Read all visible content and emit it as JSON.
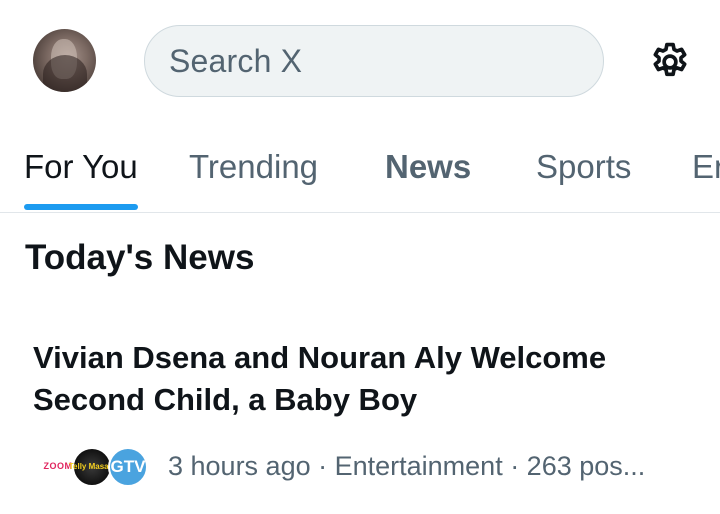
{
  "header": {
    "search_placeholder": "Search X"
  },
  "tabs": [
    {
      "label": "For You",
      "active": true
    },
    {
      "label": "Trending",
      "active": false
    },
    {
      "label": "News",
      "active": false
    },
    {
      "label": "Sports",
      "active": false
    },
    {
      "label": "Er",
      "active": false
    }
  ],
  "colors": {
    "accent": "#1d9bf0",
    "text_primary": "#0f1419",
    "text_secondary": "#536471",
    "search_bg": "#eff3f4"
  },
  "section": {
    "title": "Today's News"
  },
  "news_item": {
    "headline": "Vivian Dsena and Nouran Aly Welcome Second Child, a Baby Boy",
    "logos": {
      "zoom": "ZOOM",
      "telly": "Telly Masala",
      "gtv": "GTV"
    },
    "meta": "3 hours ago · Entertainment · 263 pos..."
  }
}
